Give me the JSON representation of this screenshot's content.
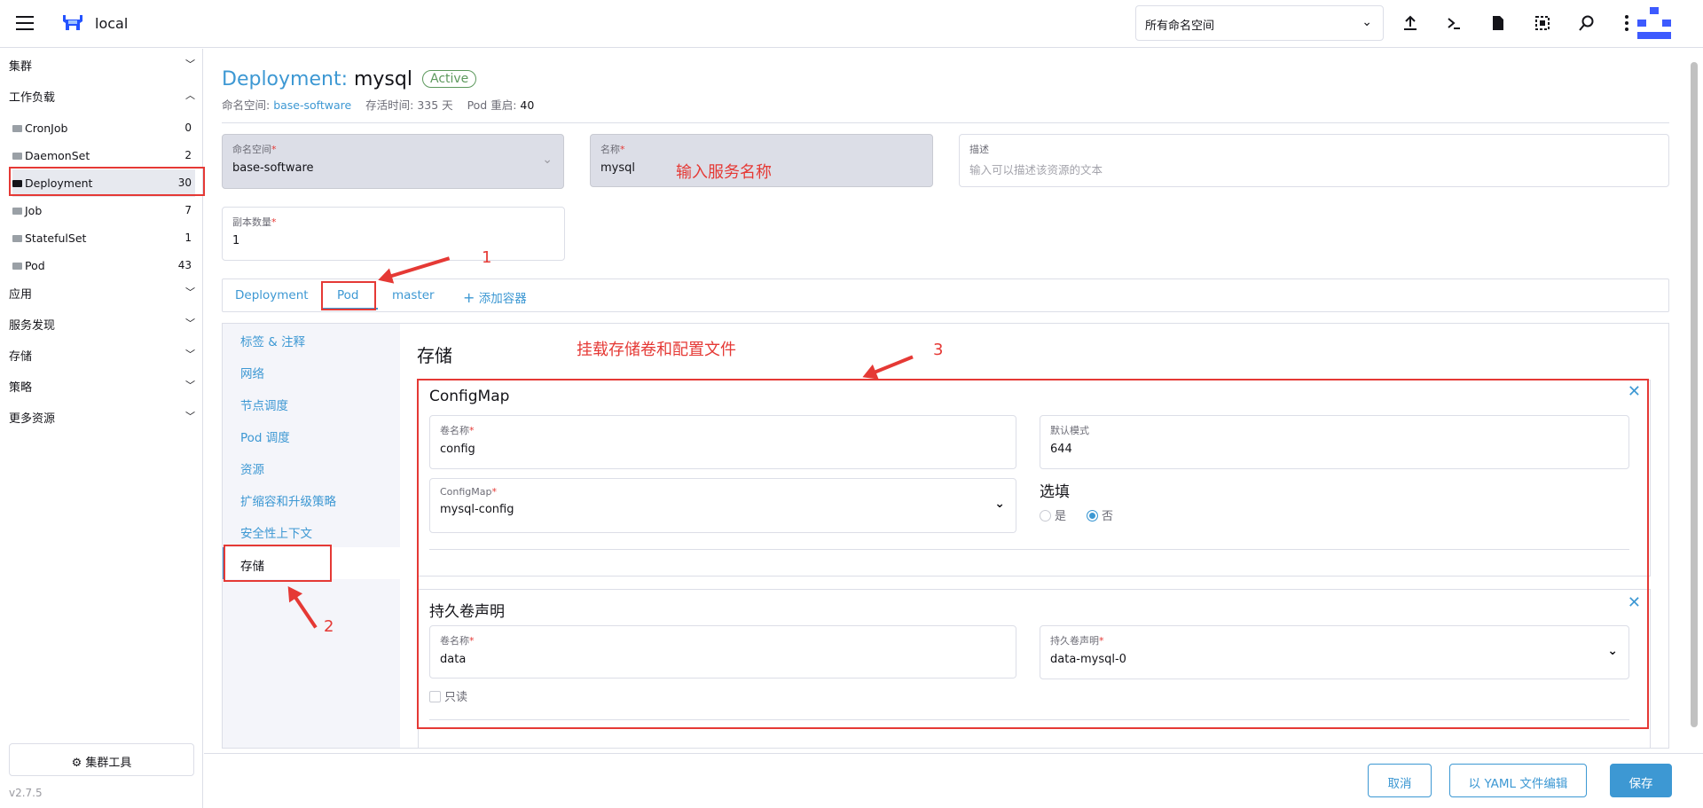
{
  "header": {
    "cluster_name": "local",
    "namespace_select": "所有命名空间"
  },
  "sidebar": {
    "groups": {
      "cluster": "集群",
      "workload": "工作负载",
      "apps": "应用",
      "service_discovery": "服务发现",
      "storage": "存储",
      "policy": "策略",
      "more": "更多资源"
    },
    "items": [
      {
        "label": "CronJob",
        "count": "0"
      },
      {
        "label": "DaemonSet",
        "count": "2"
      },
      {
        "label": "Deployment",
        "count": "30"
      },
      {
        "label": "Job",
        "count": "7"
      },
      {
        "label": "StatefulSet",
        "count": "1"
      },
      {
        "label": "Pod",
        "count": "43"
      }
    ],
    "tools_button": "集群工具",
    "version": "v2.7.5"
  },
  "page": {
    "kind": "Deployment:",
    "name": "mysql",
    "status": "Active",
    "meta": {
      "ns_label": "命名空间:",
      "ns_value": "base-software",
      "age_label": "存活时间:",
      "age_value": "335 天",
      "restarts_label": "Pod 重启:",
      "restarts_value": "40"
    }
  },
  "form": {
    "namespace": {
      "label": "命名空间",
      "value": "base-software"
    },
    "name": {
      "label": "名称",
      "value": "mysql"
    },
    "description": {
      "label": "描述",
      "placeholder": "输入可以描述该资源的文本"
    },
    "replicas": {
      "label": "副本数量",
      "value": "1"
    }
  },
  "tabs": [
    "Deployment",
    "Pod",
    "master",
    "添加容器"
  ],
  "side_tabs": [
    "标签 & 注释",
    "网络",
    "节点调度",
    "Pod 调度",
    "资源",
    "扩缩容和升级策略",
    "安全性上下文",
    "存储"
  ],
  "storage": {
    "title": "存储",
    "configmap": {
      "title": "ConfigMap",
      "vol_name_label": "卷名称",
      "vol_name_value": "config",
      "default_mode_label": "默认模式",
      "default_mode_value": "644",
      "cm_label": "ConfigMap",
      "cm_value": "mysql-config",
      "optional_title": "选填",
      "opt_yes": "是",
      "opt_no": "否"
    },
    "pvc": {
      "title": "持久卷声明",
      "vol_name_label": "卷名称",
      "vol_name_value": "data",
      "claim_label": "持久卷声明",
      "claim_value": "data-mysql-0",
      "readonly_label": "只读"
    }
  },
  "footer": {
    "cancel": "取消",
    "yaml": "以 YAML 文件编辑",
    "save": "保存"
  },
  "annotations": {
    "name_hint": "输入服务名称",
    "storage_hint": "挂载存储卷和配置文件",
    "step1": "1",
    "step2": "2",
    "step3": "3"
  },
  "colors": {
    "accent": "#3d98d3",
    "active_badge": "#5d995d",
    "annotation_red": "#e53935"
  }
}
